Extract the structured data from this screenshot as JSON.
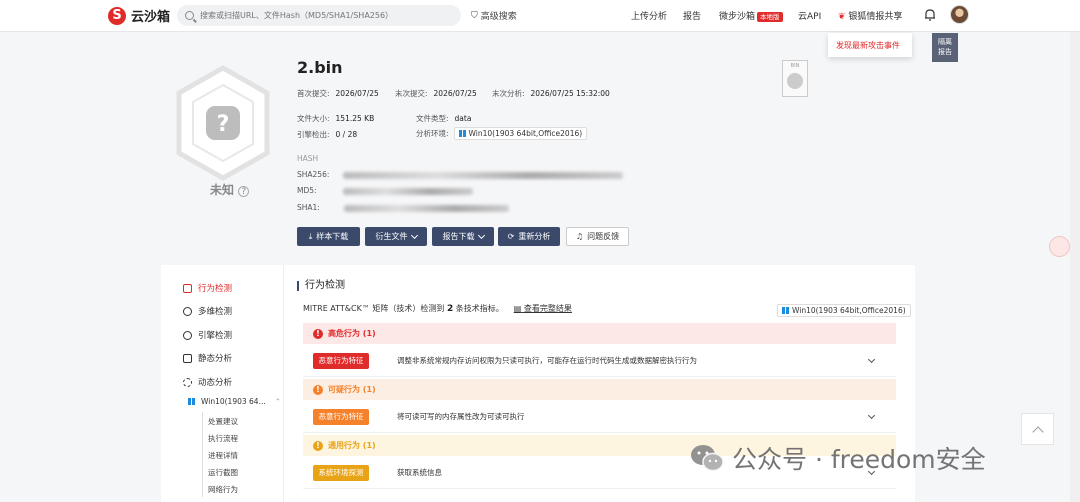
{
  "topbar": {
    "logo_mark": "S",
    "logo_text": "云沙箱",
    "search_placeholder": "搜索或扫描URL、文件Hash（MD5/SHA1/SHA256）",
    "advanced_search": "高级搜索",
    "nav": [
      "上传分析",
      "报告",
      "微步沙箱",
      "云API",
      "银狐情报共享"
    ],
    "nav_badge": "本地版",
    "dropdown_item": "发现最新攻击事件",
    "quarantine": [
      "隔离",
      "报告"
    ]
  },
  "file": {
    "name": "2.bin",
    "verdict": "未知",
    "verdict_help": "?",
    "first_submit_label": "首次提交:",
    "first_submit": "2026/07/25",
    "last_submit_label": "末次提交:",
    "last_submit": "2026/07/25",
    "last_analysis_label": "末次分析:",
    "last_analysis": "2026/07/25 15:32:00",
    "size_label": "文件大小:",
    "size": "151.25 KB",
    "type_label": "文件类型:",
    "type": "data",
    "engines_label": "引擎检出:",
    "engines": "0 / 28",
    "env_label": "分析环境:",
    "env": "Win10(1903 64bit,Office2016)",
    "hash_label": "HASH",
    "sha256_label": "SHA256:",
    "md5_label": "MD5:",
    "sha1_label": "SHA1:",
    "doc_icon_label": "BIN"
  },
  "actions": [
    "样本下载",
    "衍生文件",
    "报告下载",
    "重新分析",
    "问题反馈"
  ],
  "sidebar": {
    "items": [
      "行为检测",
      "多维检测",
      "引擎检测",
      "静态分析",
      "动态分析"
    ],
    "env_item": "Win10(1903 64...",
    "sub_items": [
      "处置建议",
      "执行流程",
      "进程详情",
      "运行截图",
      "网络行为"
    ]
  },
  "panel": {
    "title": "行为检测",
    "mitre_prefix": "MITRE ATT&CK™ 矩阵（技术）检测到",
    "mitre_count": "2",
    "mitre_suffix": "条技术指标。",
    "view_all": "查看完整结果",
    "env": "Win10(1903 64bit,Office2016)",
    "sections": [
      {
        "title": "高危行为 (1)",
        "tag": "恶意行为特征",
        "text": "调整非系统常规内存访问权限为只读可执行，可能存在运行时代码生成或数据解密执行行为",
        "color": "#e02b2b",
        "bg": "#fde8e8"
      },
      {
        "title": "可疑行为 (1)",
        "tag": "恶意行为特征",
        "text": "将可读可写的内存属性改为可读可执行",
        "color": "#f5812a",
        "bg": "#fdeee3"
      },
      {
        "title": "通用行为 (1)",
        "tag": "系统环境探测",
        "text": "获取系统信息",
        "color": "#e8a317",
        "bg": "#fdf5df"
      }
    ]
  },
  "watermark": "公众号 · freedom安全"
}
